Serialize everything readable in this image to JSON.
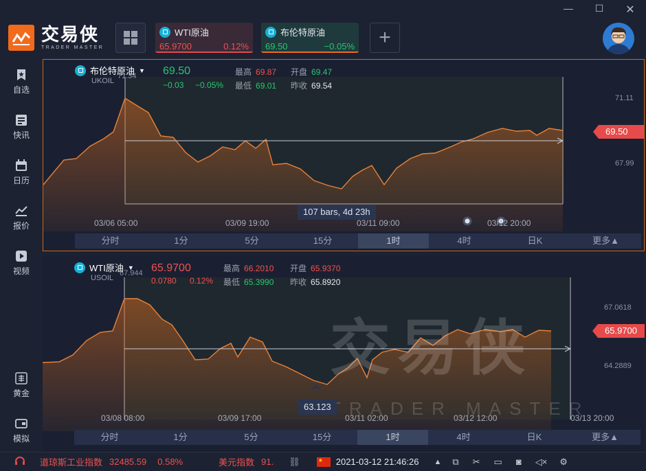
{
  "app": {
    "logo_cn": "交易侠",
    "logo_en": "TRADER MASTER"
  },
  "tabs": [
    {
      "name": "WTI原油",
      "price": "65.9700",
      "change": "0.12%"
    },
    {
      "name": "布伦特原油",
      "price": "69.50",
      "change": "−0.05%"
    }
  ],
  "sidebar": [
    {
      "label": "自选",
      "icon": "bookmark-star-icon"
    },
    {
      "label": "快讯",
      "icon": "news-list-icon"
    },
    {
      "label": "日历",
      "icon": "calendar-icon"
    },
    {
      "label": "报价",
      "icon": "quote-trend-icon"
    },
    {
      "label": "视频",
      "icon": "video-play-icon"
    },
    {
      "label": "黄金",
      "icon": "gold-icon"
    },
    {
      "label": "模拟",
      "icon": "simulation-wallet-icon"
    }
  ],
  "chart1": {
    "symbol": "布伦特原油",
    "code": "UKOIL",
    "price": "69.50",
    "chg": "−0.03",
    "chg_pct": "−0.05%",
    "high_label": "最高",
    "high": "69.87",
    "open_label": "开盘",
    "open": "69.47",
    "low_label": "最低",
    "low": "69.01",
    "prev_label": "昨收",
    "prev": "69.54",
    "peak_label": "71.34",
    "axis": [
      "71.11",
      "67.99"
    ],
    "price_tag": "69.50",
    "tooltip": "107 bars, 4d 23h",
    "times": [
      "03/06 05:00",
      "03/09 19:00",
      "03/11 09:00",
      "03/12 20:00"
    ]
  },
  "chart2": {
    "symbol": "WTI原油",
    "code": "USOIL",
    "price": "65.9700",
    "chg": "0.0780",
    "chg_pct": "0.12%",
    "high_label": "最高",
    "high": "66.2010",
    "open_label": "开盘",
    "open": "65.9370",
    "low_label": "最低",
    "low": "65.3990",
    "prev_label": "昨收",
    "prev": "65.8920",
    "peak_label": "67.944",
    "axis": [
      "67.0618",
      "64.2889"
    ],
    "price_tag": "65.9700",
    "tooltip": "63.123",
    "times": [
      "03/08 08:00",
      "03/09 17:00",
      "03/11 02:00",
      "03/12 12:00",
      "03/13 20:00"
    ]
  },
  "timeframes": [
    "分时",
    "1分",
    "5分",
    "15分",
    "1时",
    "4时",
    "日K",
    "更多▲"
  ],
  "status": {
    "dow_name": "道琼斯工业指数",
    "dow_value": "32485.59",
    "dow_pct": "0.58%",
    "usd_name": "美元指数",
    "usd_value": "91.",
    "datetime": "2021-03-12 21:46:26"
  },
  "watermark": {
    "cn": "交易侠",
    "en": "TRADER MASTER"
  },
  "colors": {
    "accent": "#f26a1b",
    "up": "#f0514e",
    "down": "#28c76f",
    "line": "#e8823a"
  }
}
